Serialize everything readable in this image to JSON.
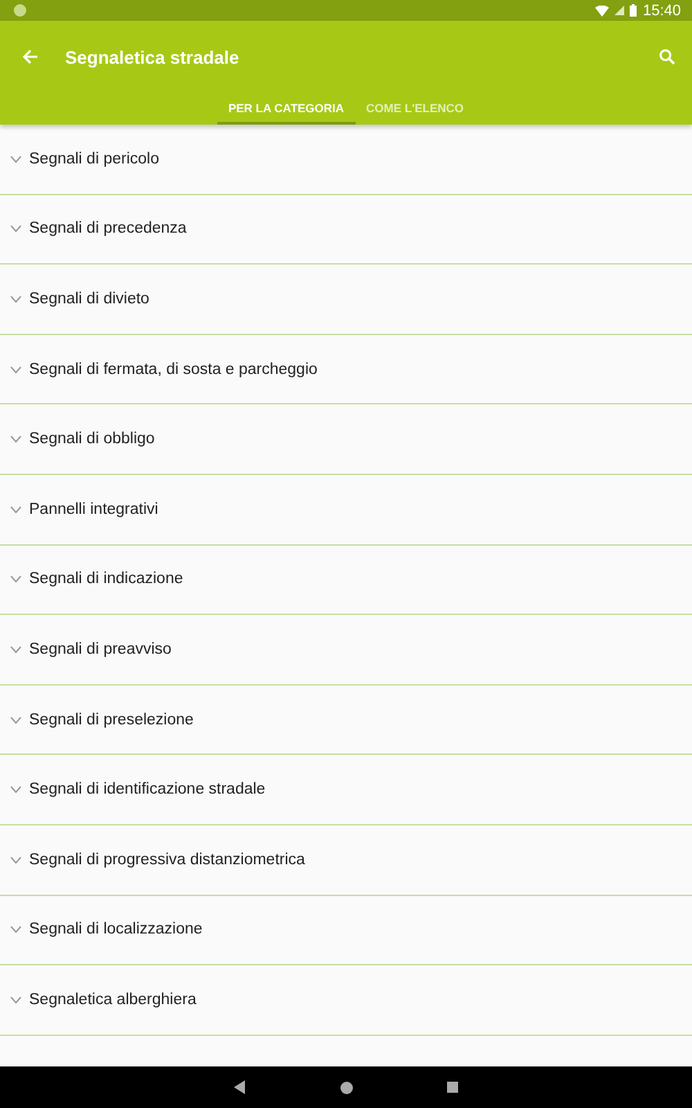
{
  "status_bar": {
    "time": "15:40"
  },
  "toolbar": {
    "title": "Segnaletica stradale"
  },
  "tabs": [
    {
      "label": "PER LA CATEGORIA",
      "selected": true
    },
    {
      "label": "COME L'ELENCO",
      "selected": false
    }
  ],
  "categories": [
    {
      "label": "Segnali di pericolo",
      "expanded": false
    },
    {
      "label": "Segnali di precedenza",
      "expanded": false
    },
    {
      "label": "Segnali di divieto",
      "expanded": false
    },
    {
      "label": "Segnali di fermata, di sosta e parcheggio",
      "expanded": false
    },
    {
      "label": "Segnali di obbligo",
      "expanded": false
    },
    {
      "label": "Pannelli integrativi",
      "expanded": false
    },
    {
      "label": "Segnali di indicazione",
      "expanded": false
    },
    {
      "label": "Segnali di preavviso",
      "expanded": false
    },
    {
      "label": "Segnali di preselezione",
      "expanded": false
    },
    {
      "label": "Segnali di identificazione stradale",
      "expanded": false
    },
    {
      "label": "Segnali di progressiva distanziometrica",
      "expanded": false
    },
    {
      "label": "Segnali di localizzazione",
      "expanded": false
    },
    {
      "label": "Segnaletica alberghiera",
      "expanded": false
    }
  ]
}
